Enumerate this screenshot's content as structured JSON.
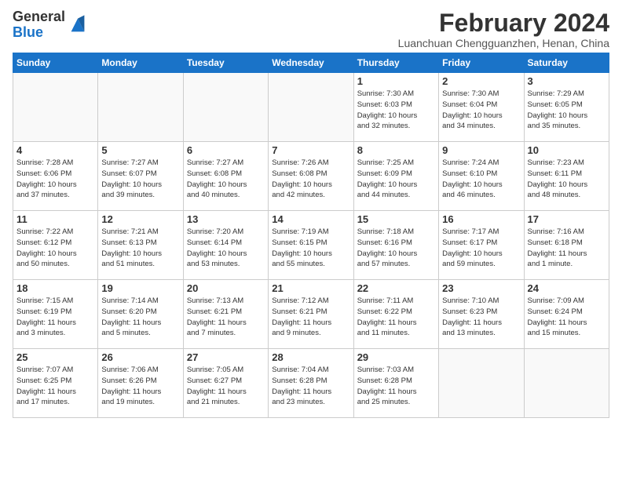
{
  "logo": {
    "line1": "General",
    "line2": "Blue"
  },
  "title": "February 2024",
  "location": "Luanchuan Chengguanzhen, Henan, China",
  "weekdays": [
    "Sunday",
    "Monday",
    "Tuesday",
    "Wednesday",
    "Thursday",
    "Friday",
    "Saturday"
  ],
  "weeks": [
    [
      {
        "day": "",
        "info": ""
      },
      {
        "day": "",
        "info": ""
      },
      {
        "day": "",
        "info": ""
      },
      {
        "day": "",
        "info": ""
      },
      {
        "day": "1",
        "info": "Sunrise: 7:30 AM\nSunset: 6:03 PM\nDaylight: 10 hours\nand 32 minutes."
      },
      {
        "day": "2",
        "info": "Sunrise: 7:30 AM\nSunset: 6:04 PM\nDaylight: 10 hours\nand 34 minutes."
      },
      {
        "day": "3",
        "info": "Sunrise: 7:29 AM\nSunset: 6:05 PM\nDaylight: 10 hours\nand 35 minutes."
      }
    ],
    [
      {
        "day": "4",
        "info": "Sunrise: 7:28 AM\nSunset: 6:06 PM\nDaylight: 10 hours\nand 37 minutes."
      },
      {
        "day": "5",
        "info": "Sunrise: 7:27 AM\nSunset: 6:07 PM\nDaylight: 10 hours\nand 39 minutes."
      },
      {
        "day": "6",
        "info": "Sunrise: 7:27 AM\nSunset: 6:08 PM\nDaylight: 10 hours\nand 40 minutes."
      },
      {
        "day": "7",
        "info": "Sunrise: 7:26 AM\nSunset: 6:08 PM\nDaylight: 10 hours\nand 42 minutes."
      },
      {
        "day": "8",
        "info": "Sunrise: 7:25 AM\nSunset: 6:09 PM\nDaylight: 10 hours\nand 44 minutes."
      },
      {
        "day": "9",
        "info": "Sunrise: 7:24 AM\nSunset: 6:10 PM\nDaylight: 10 hours\nand 46 minutes."
      },
      {
        "day": "10",
        "info": "Sunrise: 7:23 AM\nSunset: 6:11 PM\nDaylight: 10 hours\nand 48 minutes."
      }
    ],
    [
      {
        "day": "11",
        "info": "Sunrise: 7:22 AM\nSunset: 6:12 PM\nDaylight: 10 hours\nand 50 minutes."
      },
      {
        "day": "12",
        "info": "Sunrise: 7:21 AM\nSunset: 6:13 PM\nDaylight: 10 hours\nand 51 minutes."
      },
      {
        "day": "13",
        "info": "Sunrise: 7:20 AM\nSunset: 6:14 PM\nDaylight: 10 hours\nand 53 minutes."
      },
      {
        "day": "14",
        "info": "Sunrise: 7:19 AM\nSunset: 6:15 PM\nDaylight: 10 hours\nand 55 minutes."
      },
      {
        "day": "15",
        "info": "Sunrise: 7:18 AM\nSunset: 6:16 PM\nDaylight: 10 hours\nand 57 minutes."
      },
      {
        "day": "16",
        "info": "Sunrise: 7:17 AM\nSunset: 6:17 PM\nDaylight: 10 hours\nand 59 minutes."
      },
      {
        "day": "17",
        "info": "Sunrise: 7:16 AM\nSunset: 6:18 PM\nDaylight: 11 hours\nand 1 minute."
      }
    ],
    [
      {
        "day": "18",
        "info": "Sunrise: 7:15 AM\nSunset: 6:19 PM\nDaylight: 11 hours\nand 3 minutes."
      },
      {
        "day": "19",
        "info": "Sunrise: 7:14 AM\nSunset: 6:20 PM\nDaylight: 11 hours\nand 5 minutes."
      },
      {
        "day": "20",
        "info": "Sunrise: 7:13 AM\nSunset: 6:21 PM\nDaylight: 11 hours\nand 7 minutes."
      },
      {
        "day": "21",
        "info": "Sunrise: 7:12 AM\nSunset: 6:21 PM\nDaylight: 11 hours\nand 9 minutes."
      },
      {
        "day": "22",
        "info": "Sunrise: 7:11 AM\nSunset: 6:22 PM\nDaylight: 11 hours\nand 11 minutes."
      },
      {
        "day": "23",
        "info": "Sunrise: 7:10 AM\nSunset: 6:23 PM\nDaylight: 11 hours\nand 13 minutes."
      },
      {
        "day": "24",
        "info": "Sunrise: 7:09 AM\nSunset: 6:24 PM\nDaylight: 11 hours\nand 15 minutes."
      }
    ],
    [
      {
        "day": "25",
        "info": "Sunrise: 7:07 AM\nSunset: 6:25 PM\nDaylight: 11 hours\nand 17 minutes."
      },
      {
        "day": "26",
        "info": "Sunrise: 7:06 AM\nSunset: 6:26 PM\nDaylight: 11 hours\nand 19 minutes."
      },
      {
        "day": "27",
        "info": "Sunrise: 7:05 AM\nSunset: 6:27 PM\nDaylight: 11 hours\nand 21 minutes."
      },
      {
        "day": "28",
        "info": "Sunrise: 7:04 AM\nSunset: 6:28 PM\nDaylight: 11 hours\nand 23 minutes."
      },
      {
        "day": "29",
        "info": "Sunrise: 7:03 AM\nSunset: 6:28 PM\nDaylight: 11 hours\nand 25 minutes."
      },
      {
        "day": "",
        "info": ""
      },
      {
        "day": "",
        "info": ""
      }
    ]
  ]
}
